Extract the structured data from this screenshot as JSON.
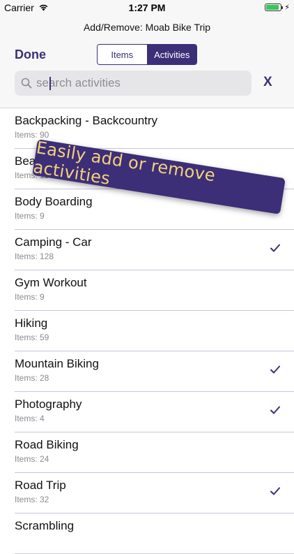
{
  "status": {
    "carrier": "Carrier",
    "time": "1:27 PM"
  },
  "nav": {
    "title": "Add/Remove: Moab Bike Trip",
    "done_label": "Done"
  },
  "segments": {
    "items_label": "Items",
    "activities_label": "Activities",
    "selected": "Activities"
  },
  "search": {
    "placeholder": "search activities",
    "value": "",
    "clear_label": "X"
  },
  "banner": {
    "text": "Easily add or remove activities"
  },
  "activities": [
    {
      "name": "Backpacking - Backcountry",
      "count": "Items: 90",
      "checked": false
    },
    {
      "name": "Beach",
      "count": "Items: 11",
      "checked": false
    },
    {
      "name": "Body Boarding",
      "count": "Items: 9",
      "checked": false
    },
    {
      "name": "Camping - Car",
      "count": "Items: 128",
      "checked": true
    },
    {
      "name": "Gym Workout",
      "count": "Items: 9",
      "checked": false
    },
    {
      "name": "Hiking",
      "count": "Items: 59",
      "checked": false
    },
    {
      "name": "Mountain Biking",
      "count": "Items: 28",
      "checked": true
    },
    {
      "name": "Photography",
      "count": "Items: 4",
      "checked": true
    },
    {
      "name": "Road Biking",
      "count": "Items: 24",
      "checked": false
    },
    {
      "name": "Road Trip",
      "count": "Items: 32",
      "checked": true
    },
    {
      "name": "Scrambling",
      "count": "",
      "checked": false
    }
  ],
  "colors": {
    "accent": "#3d2e78",
    "banner_text": "#f3d27a",
    "battery": "#34c759"
  }
}
